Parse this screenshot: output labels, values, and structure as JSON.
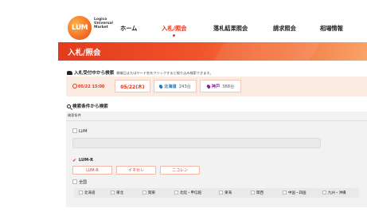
{
  "header": {
    "logo_text": "LUM",
    "logo_caption": "Logico Universal Market",
    "nav": [
      "ホーム",
      "入札/照会",
      "落札結果照会",
      "請求照会",
      "相場情報"
    ],
    "active_nav": "入札/照会"
  },
  "banner": {
    "title": "入札/照会"
  },
  "receipt": {
    "title": "入札受付中から検索",
    "note": "開催日またはヤード名をクリックすると絞り込み検索できます。",
    "time": "05/22 15:00",
    "date": "05/22(木)",
    "locations": [
      {
        "name": "北海道",
        "count": "243台"
      },
      {
        "name": "神戸",
        "count": "368台"
      }
    ]
  },
  "conditions": {
    "title": "検索条件から検索",
    "label": "検索条件",
    "lum_label": "LUM",
    "lum_input_value": "",
    "lumr_label": "LUM-R",
    "lumr_options": [
      "LUM-R",
      "イネセレ",
      "ニコレン"
    ],
    "all_label": "全国",
    "regions": [
      "北海道",
      "東北",
      "関東",
      "北陸・甲信越",
      "東海",
      "関西",
      "中国・四国",
      "九州・沖縄"
    ]
  },
  "colors": {
    "accent": "#e8341c",
    "banner_start": "#e23a1e",
    "banner_end": "#f8a36a",
    "panel_bg": "#f2f2f2",
    "date_box_bg": "#fcebe3",
    "hokkaido_pin": "#1e78c8",
    "kobe_pin": "#7a2a8c"
  },
  "icons": [
    "truck-icon",
    "clock-icon",
    "map-pin-icon",
    "search-icon",
    "checkbox-icon",
    "checkmark-icon"
  ]
}
